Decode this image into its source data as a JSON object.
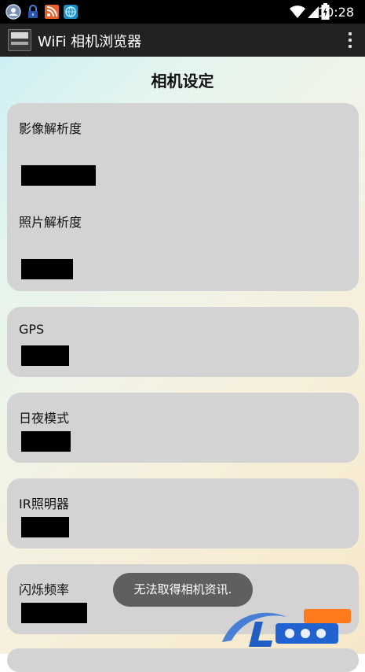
{
  "status_bar": {
    "time": "10:28",
    "left_icons": [
      "user-notification-icon",
      "lock-notification-icon",
      "rss-notification-icon",
      "browser-notification-icon"
    ],
    "right_icons": [
      "wifi-icon",
      "signal-icon",
      "battery-icon"
    ]
  },
  "app_bar": {
    "title": "WiFi 相机浏览器",
    "logo_icon": "night-vision-logo-icon",
    "menu_icon": "overflow-menu-icon"
  },
  "page": {
    "title": "相机设定",
    "sections": [
      {
        "label": "影像解析度"
      },
      {
        "label": "照片解析度"
      },
      {
        "label": "GPS"
      },
      {
        "label": "日夜模式"
      },
      {
        "label": "IR照明器"
      },
      {
        "label": "闪烁频率"
      }
    ]
  },
  "toast": {
    "message": "无法取得相机资讯."
  },
  "colors": {
    "status_bar": "#000000",
    "app_bar": "#222222",
    "card": "#d3d3d3",
    "toast": "#5f5f5f"
  }
}
